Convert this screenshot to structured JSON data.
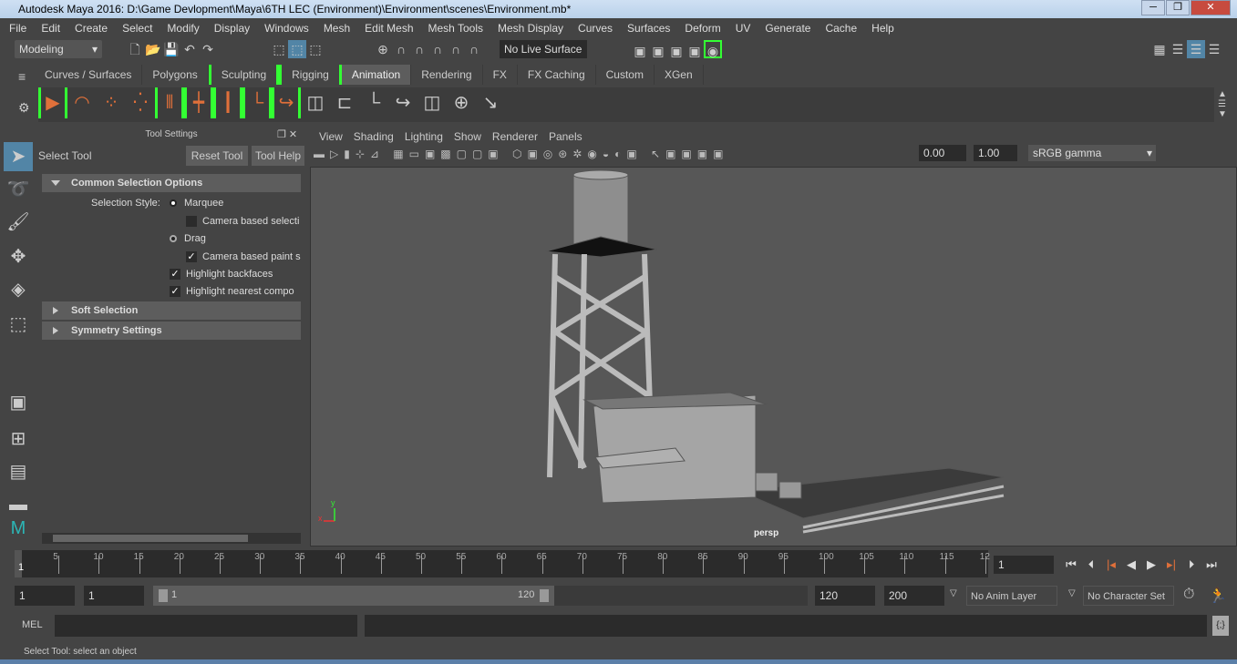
{
  "window": {
    "title": "Autodesk Maya 2016: D:\\Game Devlopment\\Maya\\6TH LEC (Environment)\\Environment\\scenes\\Environment.mb*",
    "min": "─",
    "max": "❐",
    "close": "✕"
  },
  "menu": [
    "File",
    "Edit",
    "Create",
    "Select",
    "Modify",
    "Display",
    "Windows",
    "Mesh",
    "Edit Mesh",
    "Mesh Tools",
    "Mesh Display",
    "Curves",
    "Surfaces",
    "Deform",
    "UV",
    "Generate",
    "Cache",
    "Help"
  ],
  "status_line": {
    "menu_set": "Modeling",
    "live_surface": "No Live Surface"
  },
  "shelf_tabs": [
    {
      "label": "Curves / Surfaces"
    },
    {
      "label": "Polygons"
    },
    {
      "label": "Sculpting"
    },
    {
      "label": "Rigging"
    },
    {
      "label": "Animation",
      "active": true
    },
    {
      "label": "Rendering"
    },
    {
      "label": "FX"
    },
    {
      "label": "FX Caching"
    },
    {
      "label": "Custom"
    },
    {
      "label": "XGen"
    }
  ],
  "shelf_icons": [
    "playblast-icon",
    "motion-trail-icon",
    "ghost-icon",
    "unghost-icon",
    "bake-icon",
    "set-key-icon",
    "breakdown-icon",
    "set-driven-key-icon",
    "ik-spline-icon",
    "constraint-icon",
    "parent-constraint-icon",
    "point-constraint-icon",
    "orient-constraint-icon",
    "scale-constraint-icon",
    "aim-constraint-icon",
    "pole-vector-icon"
  ],
  "tool_settings": {
    "header": "Tool Settings",
    "tool_name": "Select Tool",
    "reset": "Reset Tool",
    "help": "Tool Help",
    "sections": {
      "common": "Common Selection Options",
      "soft": "Soft Selection",
      "symmetry": "Symmetry Settings"
    },
    "selection_style_label": "Selection Style:",
    "options": {
      "marquee": "Marquee",
      "camera_select": "Camera based selecti",
      "drag": "Drag",
      "camera_paint": "Camera based paint s",
      "highlight_backfaces": "Highlight backfaces",
      "highlight_nearest": "Highlight nearest compo"
    }
  },
  "viewport": {
    "menus": [
      "View",
      "Shading",
      "Lighting",
      "Show",
      "Renderer",
      "Panels"
    ],
    "exposure": "0.00",
    "gamma": "1.00",
    "color_space": "sRGB gamma",
    "camera": "persp",
    "axis_y": "y",
    "axis_x": "x"
  },
  "timeline": {
    "ticks": [
      "5",
      "10",
      "15",
      "20",
      "25",
      "30",
      "35",
      "40",
      "45",
      "50",
      "55",
      "60",
      "65",
      "70",
      "75",
      "80",
      "85",
      "90",
      "95",
      "100",
      "105",
      "110",
      "115",
      "12"
    ],
    "current": "1",
    "current_field": "1"
  },
  "range": {
    "start": "1",
    "playback_start": "1",
    "slider_min": "1",
    "slider_max": "120",
    "playback_end": "120",
    "end": "200",
    "anim_layer": "No Anim Layer",
    "char_set": "No Character Set"
  },
  "command": {
    "label": "MEL"
  },
  "help_line": "Select Tool: select an object",
  "colors": {
    "accent": "#5285a6",
    "green": "#33ff33",
    "orange": "#e0703a"
  }
}
